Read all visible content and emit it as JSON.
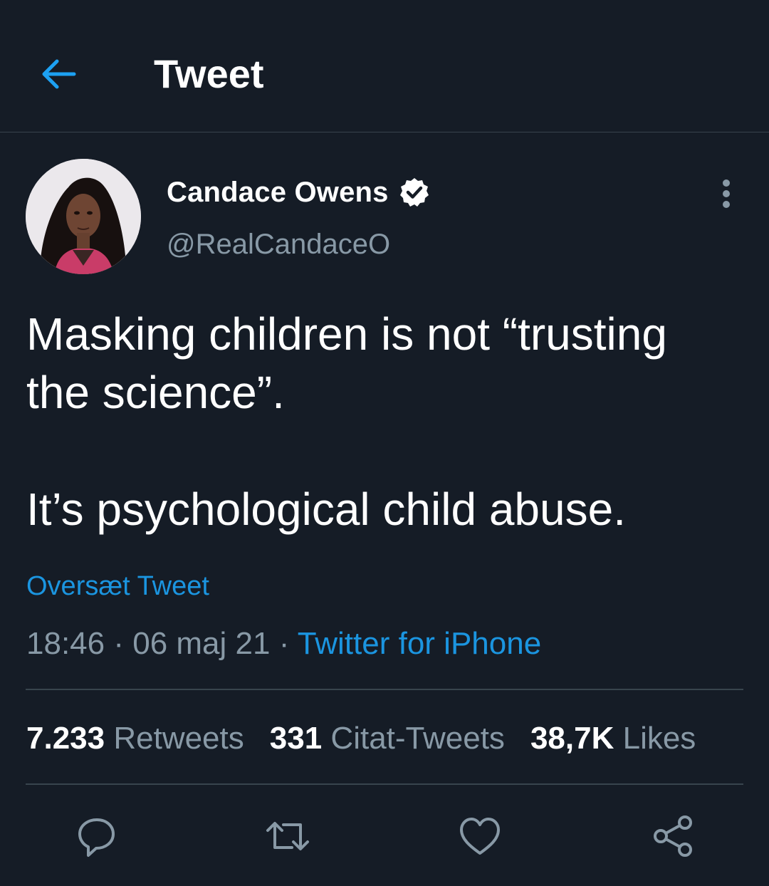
{
  "header": {
    "title": "Tweet",
    "back_icon": "arrow-left-icon"
  },
  "author": {
    "display_name": "Candace Owens",
    "handle": "@RealCandaceO",
    "verified": true
  },
  "tweet": {
    "lines": [
      "Masking children is not “trusting",
      "the science”."
    ],
    "line2": "It’s psychological child abuse.",
    "translate_label": "Oversæt Tweet",
    "time": "18:46",
    "date": "06 maj 21",
    "separator": "·",
    "source": "Twitter for iPhone"
  },
  "stats": {
    "retweets_count": "7.233",
    "retweets_label": "Retweets",
    "quotes_count": "331",
    "quotes_label": "Citat-Tweets",
    "likes_count": "38,7K",
    "likes_label": "Likes"
  },
  "actions": [
    "reply-icon",
    "retweet-icon",
    "like-icon",
    "share-icon"
  ],
  "colors": {
    "background": "#151c26",
    "accent": "#1b95e0",
    "muted": "#8899a6",
    "divider": "#38444d"
  }
}
